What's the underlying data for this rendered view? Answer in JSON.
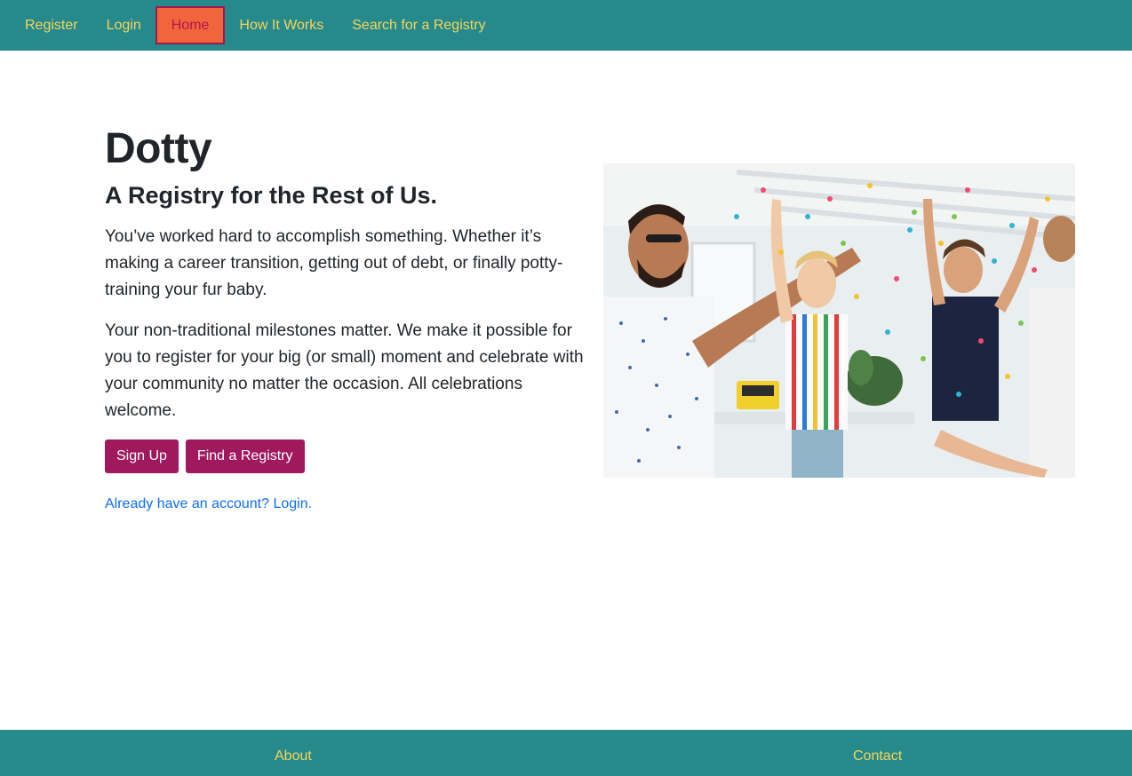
{
  "nav": {
    "items": [
      {
        "label": "Register"
      },
      {
        "label": "Login"
      },
      {
        "label": "Home"
      },
      {
        "label": "How It Works"
      },
      {
        "label": "Search for a Registry"
      }
    ],
    "active": "Home"
  },
  "hero": {
    "brand": "Dotty",
    "tagline": "A Registry for the Rest of Us.",
    "paragraph1": "You’ve worked hard to accomplish something. Whether it’s making a career transition, getting out of debt, or finally potty-training your fur baby.",
    "paragraph2": "Your non-traditional milestones matter. We make it possible for you to register for your big (or small) moment and celebrate with your community no matter the occasion. All celebrations welcome.",
    "signup_label": "Sign Up",
    "find_label": "Find a Registry",
    "login_link": "Already have an account? Login."
  },
  "footer": {
    "about": "About",
    "contact": "Contact"
  },
  "colors": {
    "navbar": "#268a8c",
    "nav_text": "#f5d55a",
    "active_bg": "#f0653c",
    "active_text": "#b3154f",
    "button": "#a0195f",
    "link": "#0d6efd"
  }
}
